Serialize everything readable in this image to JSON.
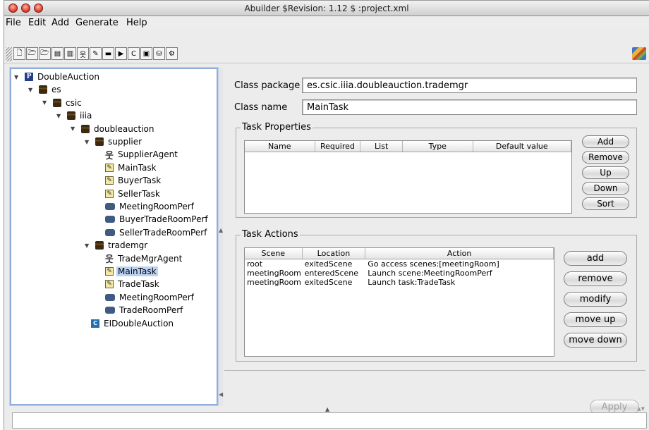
{
  "window": {
    "title": "Abuilder $Revision: 1.12 $ :project.xml"
  },
  "menubar": {
    "items": [
      "File",
      "Edit",
      "Add",
      "Generate",
      "Help"
    ]
  },
  "toolbar": {
    "buttons": [
      {
        "name": "new-file-icon",
        "glyph": "🗋"
      },
      {
        "name": "open-folder-icon",
        "glyph": "🗁"
      },
      {
        "name": "open-project-icon",
        "glyph": "🗁"
      },
      {
        "name": "save-icon",
        "glyph": "▤"
      },
      {
        "name": "save-as-icon",
        "glyph": "▥"
      },
      {
        "name": "agent-icon",
        "glyph": "웃"
      },
      {
        "name": "task-icon",
        "glyph": "✎"
      },
      {
        "name": "performative-icon",
        "glyph": "▬"
      },
      {
        "name": "scene-icon",
        "glyph": "▶"
      },
      {
        "name": "class-icon",
        "glyph": "C"
      },
      {
        "name": "package-icon",
        "glyph": "▣"
      },
      {
        "name": "database-icon",
        "glyph": "⛁"
      },
      {
        "name": "generate-gear-icon",
        "glyph": "⚙"
      }
    ]
  },
  "tree": {
    "nodes": [
      {
        "label": "DoubleAuction",
        "icon": "project",
        "glyph": "P",
        "depth": 0,
        "expanded": true
      },
      {
        "label": "es",
        "icon": "package",
        "glyph": "",
        "depth": 1,
        "expanded": true
      },
      {
        "label": "csic",
        "icon": "package",
        "glyph": "",
        "depth": 2,
        "expanded": true
      },
      {
        "label": "iiia",
        "icon": "package",
        "glyph": "",
        "depth": 3,
        "expanded": true
      },
      {
        "label": "doubleauction",
        "icon": "package",
        "glyph": "",
        "depth": 4,
        "expanded": true
      },
      {
        "label": "supplier",
        "icon": "package",
        "glyph": "",
        "depth": 5,
        "expanded": true
      },
      {
        "label": "SupplierAgent",
        "icon": "agent",
        "glyph": "웃",
        "depth": 6
      },
      {
        "label": "MainTask",
        "icon": "task",
        "glyph": "✎",
        "depth": 6
      },
      {
        "label": "BuyerTask",
        "icon": "task",
        "glyph": "✎",
        "depth": 6
      },
      {
        "label": "SellerTask",
        "icon": "task",
        "glyph": "✎",
        "depth": 6
      },
      {
        "label": "MeetingRoomPerf",
        "icon": "perf",
        "glyph": "",
        "depth": 6
      },
      {
        "label": "BuyerTradeRoomPerf",
        "icon": "perf",
        "glyph": "",
        "depth": 6
      },
      {
        "label": "SellerTradeRoomPerf",
        "icon": "perf",
        "glyph": "",
        "depth": 6
      },
      {
        "label": "trademgr",
        "icon": "package",
        "glyph": "",
        "depth": 5,
        "expanded": true
      },
      {
        "label": "TradeMgrAgent",
        "icon": "agent",
        "glyph": "웃",
        "depth": 6
      },
      {
        "label": "MainTask",
        "icon": "task",
        "glyph": "✎",
        "depth": 6,
        "selected": true
      },
      {
        "label": "TradeTask",
        "icon": "task",
        "glyph": "✎",
        "depth": 6
      },
      {
        "label": "MeetingRoomPerf",
        "icon": "perf",
        "glyph": "",
        "depth": 6
      },
      {
        "label": "TradeRoomPerf",
        "icon": "perf",
        "glyph": "",
        "depth": 6
      },
      {
        "label": "EIDoubleAuction",
        "icon": "class",
        "glyph": "C",
        "depth": 5
      }
    ]
  },
  "form": {
    "class_package_label": "Class package",
    "class_package_value": "es.csic.iiia.doubleauction.trademgr",
    "class_name_label": "Class name",
    "class_name_value": "MainTask"
  },
  "task_properties": {
    "title": "Task Properties",
    "columns": [
      "Name",
      "Required",
      "List",
      "Type",
      "Default value"
    ],
    "rows": [],
    "buttons": [
      "Add",
      "Remove",
      "Up",
      "Down",
      "Sort"
    ]
  },
  "task_actions": {
    "title": "Task Actions",
    "columns": [
      "Scene",
      "Location",
      "Action"
    ],
    "rows": [
      [
        "root",
        "exitedScene",
        "Go access scenes:[meetingRoom]"
      ],
      [
        "meetingRoom",
        "enteredScene",
        "Launch scene:MeetingRoomPerf"
      ],
      [
        "meetingRoom",
        "exitedScene",
        "Launch task:TradeTask"
      ]
    ],
    "buttons": [
      "add",
      "remove",
      "modify",
      "move up",
      "move down"
    ]
  },
  "footer": {
    "apply_label": "Apply"
  }
}
